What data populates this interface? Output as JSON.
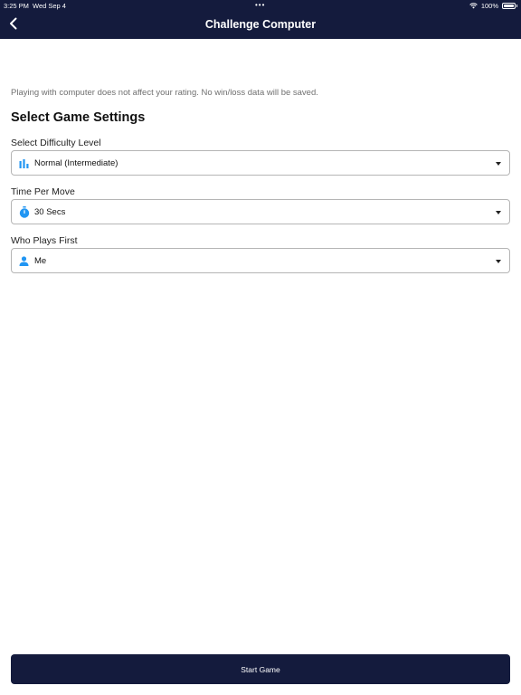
{
  "status_bar": {
    "time": "3:25 PM",
    "date": "Wed Sep 4",
    "dots": "•••",
    "battery": "100%"
  },
  "nav": {
    "title": "Challenge Computer"
  },
  "main": {
    "note": "Playing with computer does not affect your rating. No win/loss data will be saved.",
    "heading": "Select Game Settings",
    "fields": [
      {
        "label": "Select Difficulty Level",
        "value": "Normal (Intermediate)",
        "icon": "bar-chart-icon"
      },
      {
        "label": "Time Per Move",
        "value": "30 Secs",
        "icon": "timer-icon"
      },
      {
        "label": "Who Plays First",
        "value": "Me",
        "icon": "person-icon"
      }
    ]
  },
  "footer": {
    "start_label": "Start Game"
  },
  "colors": {
    "navy": "#141b3d",
    "accent": "#2196f3"
  }
}
